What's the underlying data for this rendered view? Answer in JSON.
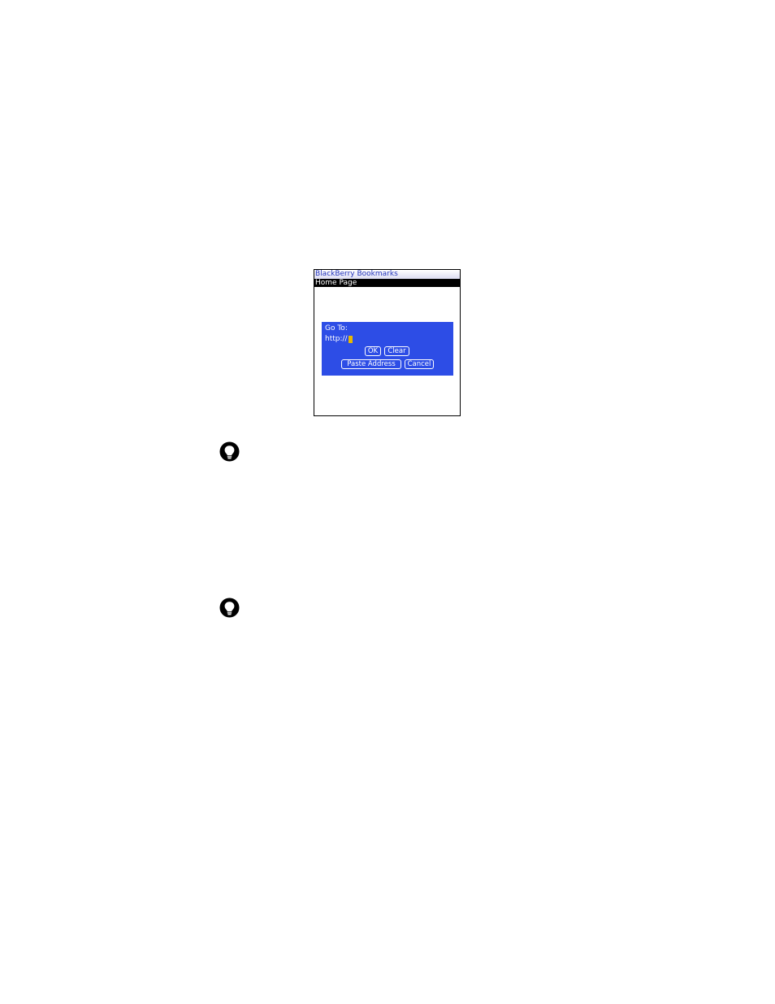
{
  "device": {
    "title": "BlackBerry Bookmarks",
    "selected_item": "Home Page"
  },
  "dialog": {
    "label": "Go To:",
    "url_value": "http://",
    "buttons": {
      "ok": "OK",
      "clear": "Clear",
      "paste_address": "Paste Address",
      "cancel": "Cancel"
    }
  },
  "icons": {
    "tip_1": "lightbulb-icon",
    "tip_2": "lightbulb-icon"
  },
  "colors": {
    "dialog_background": "#2d4de6",
    "title_text": "#2233bb",
    "cursor": "#e8b800"
  }
}
